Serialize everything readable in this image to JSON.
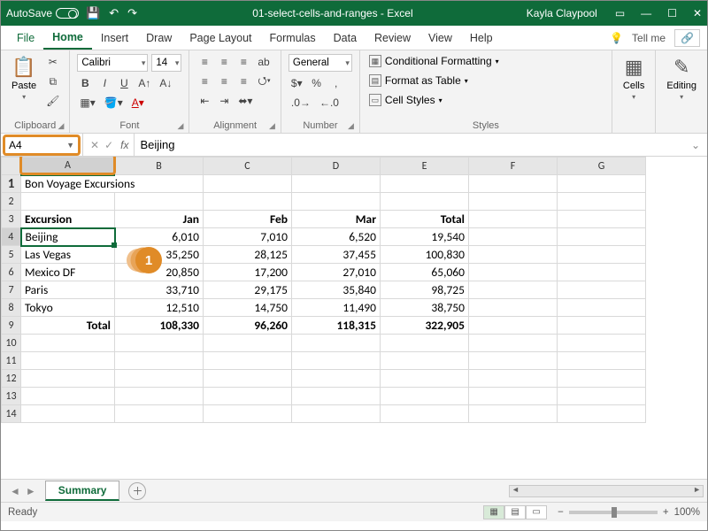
{
  "titlebar": {
    "autosave": "AutoSave",
    "doc": "01-select-cells-and-ranges - Excel",
    "user": "Kayla Claypool"
  },
  "tabs": {
    "file": "File",
    "home": "Home",
    "insert": "Insert",
    "draw": "Draw",
    "pagelayout": "Page Layout",
    "formulas": "Formulas",
    "data": "Data",
    "review": "Review",
    "view": "View",
    "help": "Help",
    "tellme": "Tell me"
  },
  "ribbon": {
    "clipboard": {
      "paste": "Paste",
      "label": "Clipboard"
    },
    "font": {
      "name": "Calibri",
      "size": "14",
      "label": "Font"
    },
    "alignment": {
      "label": "Alignment"
    },
    "number": {
      "format": "General",
      "label": "Number"
    },
    "styles": {
      "cond": "Conditional Formatting",
      "table": "Format as Table",
      "cell": "Cell Styles",
      "label": "Styles"
    },
    "cells": {
      "label": "Cells"
    },
    "editing": {
      "label": "Editing"
    }
  },
  "fbar": {
    "name": "A4",
    "fx": "fx",
    "formula": "Beijing"
  },
  "columns": [
    "A",
    "B",
    "C",
    "D",
    "E",
    "F",
    "G"
  ],
  "sheet": {
    "title": "Bon Voyage Excursions",
    "headers": {
      "a": "Excursion",
      "b": "Jan",
      "c": "Feb",
      "d": "Mar",
      "e": "Total"
    },
    "rows": [
      {
        "a": "Beijing",
        "b": "6,010",
        "c": "7,010",
        "d": "6,520",
        "e": "19,540"
      },
      {
        "a": "Las Vegas",
        "b": "35,250",
        "c": "28,125",
        "d": "37,455",
        "e": "100,830"
      },
      {
        "a": "Mexico DF",
        "b": "20,850",
        "c": "17,200",
        "d": "27,010",
        "e": "65,060"
      },
      {
        "a": "Paris",
        "b": "33,710",
        "c": "29,175",
        "d": "35,840",
        "e": "98,725"
      },
      {
        "a": "Tokyo",
        "b": "12,510",
        "c": "14,750",
        "d": "11,490",
        "e": "38,750"
      }
    ],
    "total": {
      "a": "Total",
      "b": "108,330",
      "c": "96,260",
      "d": "118,315",
      "e": "322,905"
    }
  },
  "sheets": {
    "active": "Summary"
  },
  "status": {
    "ready": "Ready",
    "zoom": "100%"
  },
  "callout": "1",
  "chart_data": {
    "type": "table",
    "title": "Bon Voyage Excursions",
    "columns": [
      "Excursion",
      "Jan",
      "Feb",
      "Mar",
      "Total"
    ],
    "rows": [
      [
        "Beijing",
        6010,
        7010,
        6520,
        19540
      ],
      [
        "Las Vegas",
        35250,
        28125,
        37455,
        100830
      ],
      [
        "Mexico DF",
        20850,
        17200,
        27010,
        65060
      ],
      [
        "Paris",
        33710,
        29175,
        35840,
        98725
      ],
      [
        "Tokyo",
        12510,
        14750,
        11490,
        38750
      ],
      [
        "Total",
        108330,
        96260,
        118315,
        322905
      ]
    ]
  }
}
